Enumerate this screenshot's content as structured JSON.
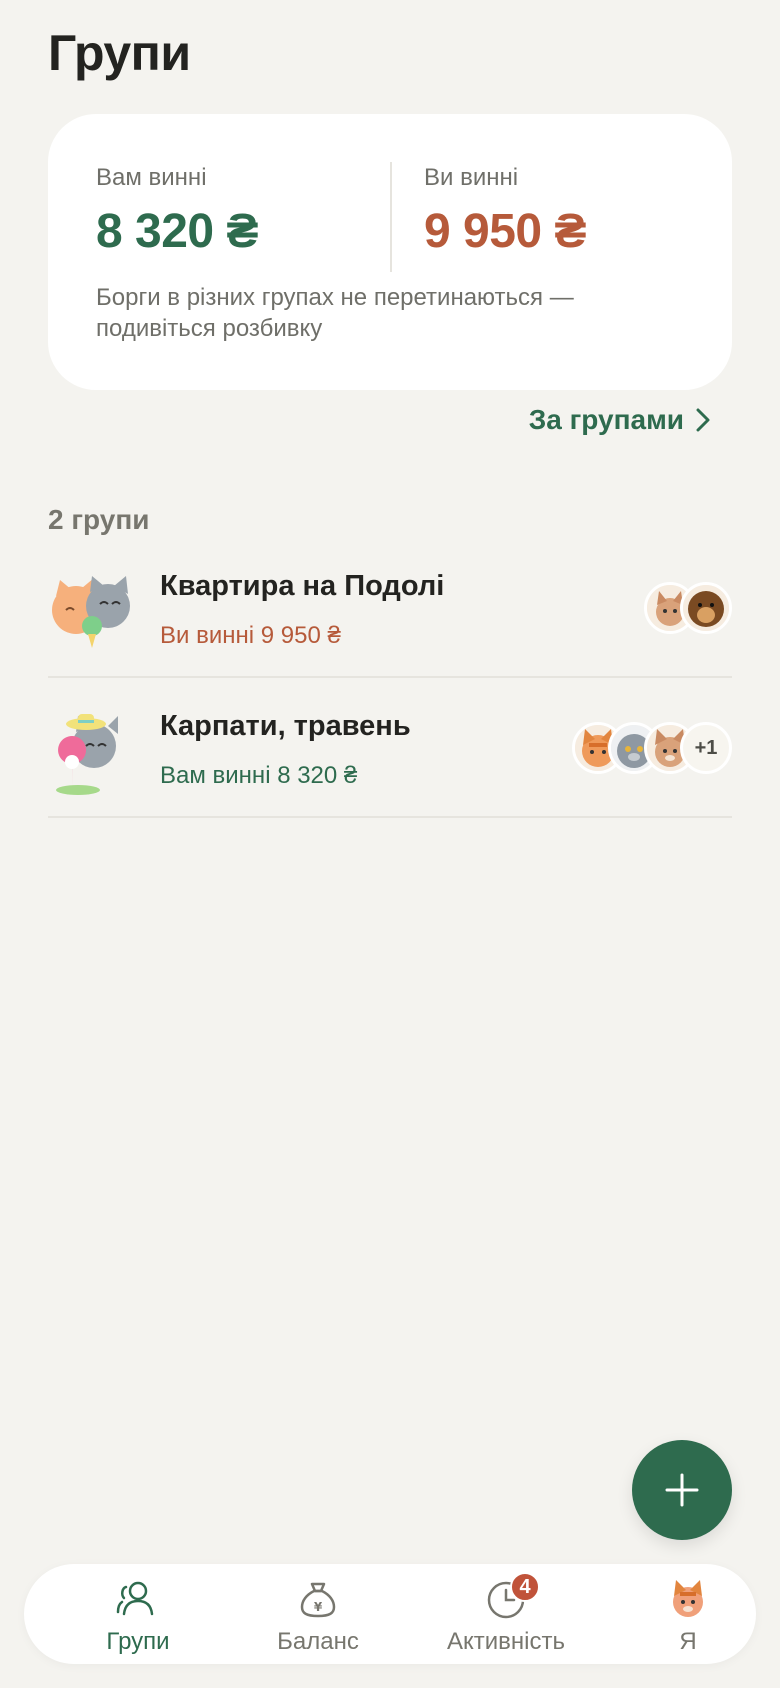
{
  "header": {
    "title": "Групи"
  },
  "summary": {
    "owed_to_you_label": "Вам винні",
    "owed_to_you_amount": "8 320 ₴",
    "you_owe_label": "Ви винні",
    "you_owe_amount": "9 950 ₴",
    "note": "Борги в різних групах не перетинаються — подивіться розбивку",
    "by_groups_link": "За групами"
  },
  "groups_section": {
    "count_label": "2 групи",
    "groups": [
      {
        "name": "Квартира на Подолі",
        "status": "Ви винні 9 950 ₴",
        "avatar": "two-cats-sticker",
        "members": [
          "cat-avatar",
          "dog-avatar"
        ]
      },
      {
        "name": "Карпати, травень",
        "status": "Вам винні 8 320 ₴",
        "avatar": "cat-with-pin-sticker",
        "members": [
          "orange-cat-avatar",
          "grey-cat-avatar",
          "tabby-cat-avatar"
        ],
        "more_members": "+1"
      }
    ]
  },
  "fab": {
    "icon": "plus-icon"
  },
  "tabbar": {
    "tabs": [
      {
        "label": "Групи",
        "icon": "people-icon",
        "active": true
      },
      {
        "label": "Баланс",
        "icon": "money-bag-icon"
      },
      {
        "label": "Активність",
        "icon": "clock-icon",
        "badge": "4"
      },
      {
        "label": "Я",
        "icon": "profile-avatar"
      }
    ]
  },
  "colors": {
    "accent": "#2e6b4e",
    "negative": "#b65a3a",
    "badge": "#c0533a",
    "background": "#f4f3ef"
  }
}
